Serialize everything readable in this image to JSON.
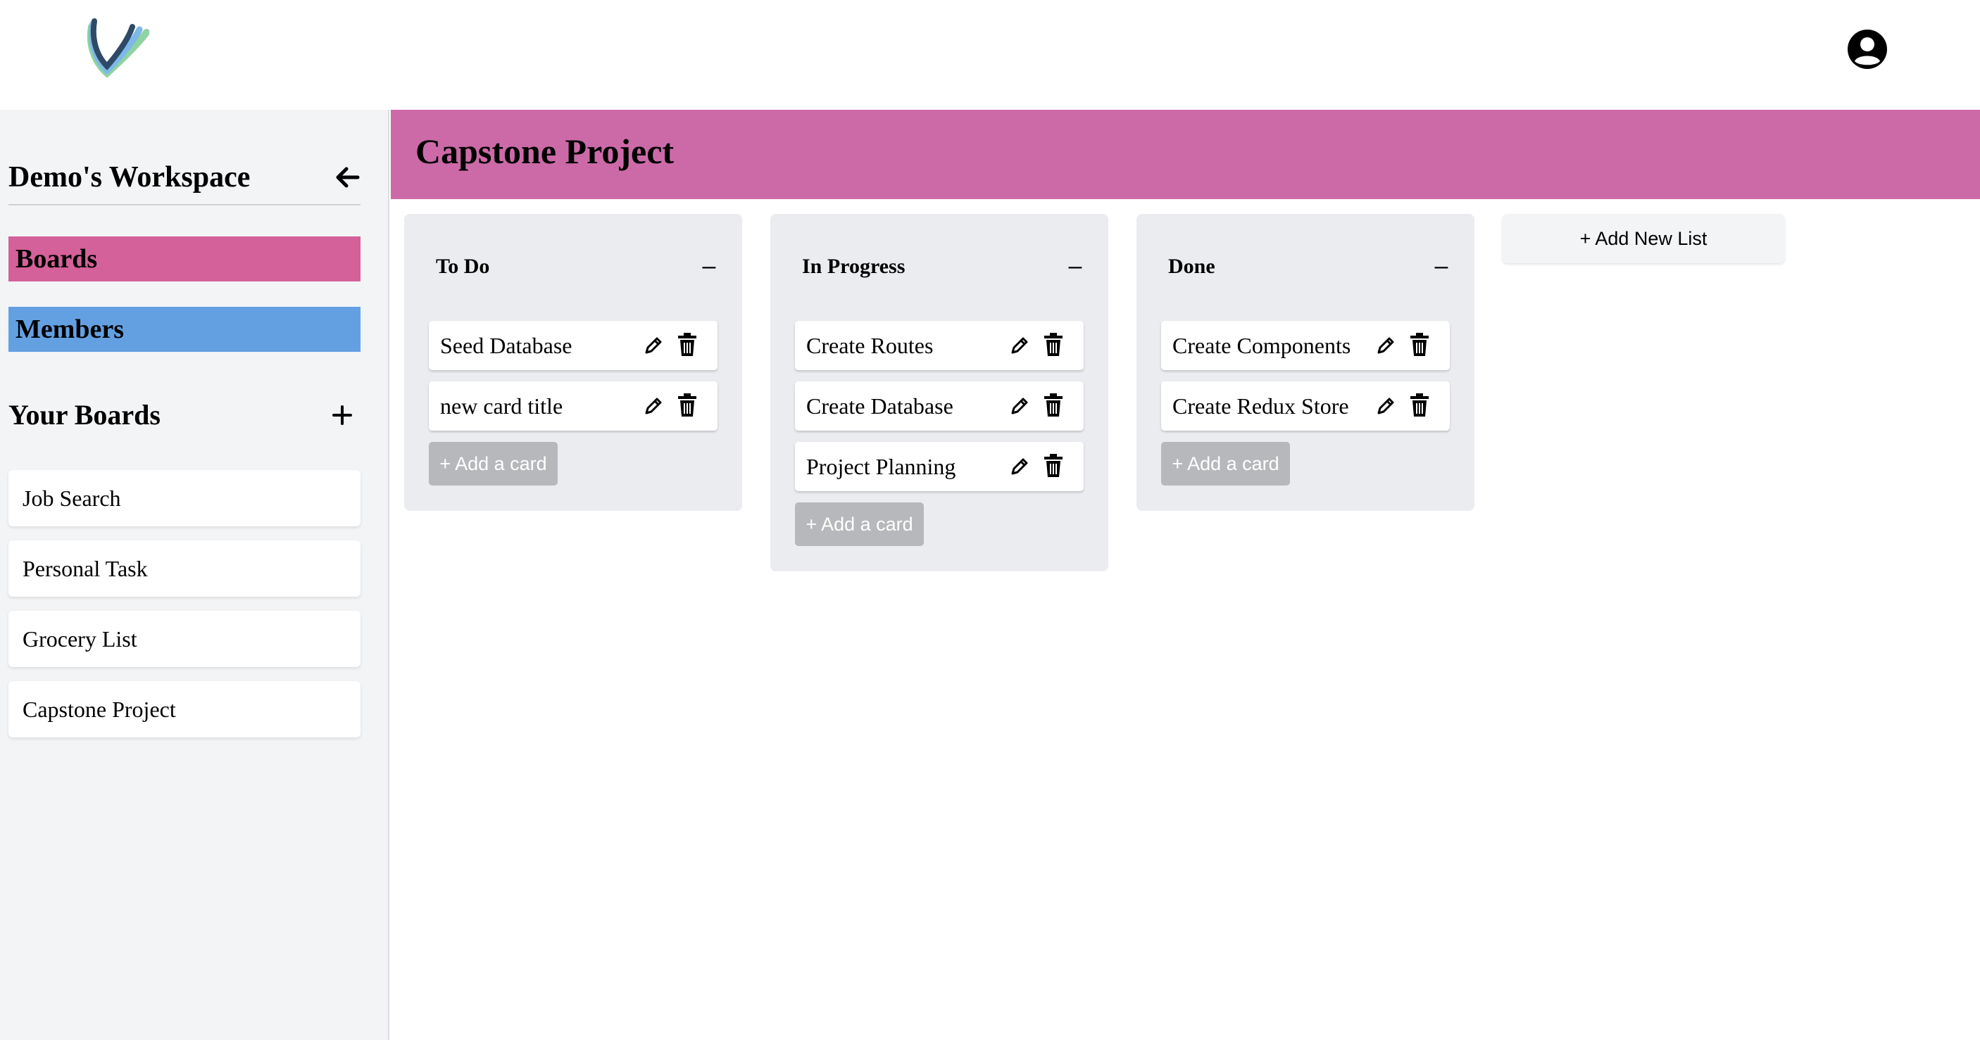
{
  "header": {
    "logo_icon": "logo-icon",
    "profile_icon": "user-circle-icon"
  },
  "sidebar": {
    "workspace_title": "Demo's Workspace",
    "collapse_icon": "arrow-left-icon",
    "nav": [
      {
        "label": "Boards",
        "color": "#d46199"
      },
      {
        "label": "Members",
        "color": "#63a0e2"
      }
    ],
    "your_boards_title": "Your Boards",
    "add_board_icon": "plus-icon",
    "boards": [
      "Job Search",
      "Personal Task",
      "Grocery List",
      "Capstone Project"
    ]
  },
  "board": {
    "title": "Capstone Project",
    "banner_color": "#cc6aa8",
    "lists": [
      {
        "title": "To Do",
        "collapse_label": "–",
        "cards": [
          "Seed Database",
          "new card title"
        ],
        "add_card_label": "+ Add a card"
      },
      {
        "title": "In Progress",
        "collapse_label": "–",
        "cards": [
          "Create Routes",
          "Create Database",
          "Project Planning"
        ],
        "add_card_label": "+ Add a card"
      },
      {
        "title": "Done",
        "collapse_label": "–",
        "cards": [
          "Create Components",
          "Create Redux Store"
        ],
        "add_card_label": "+ Add a card"
      }
    ],
    "add_list_label": "+ Add New List"
  }
}
